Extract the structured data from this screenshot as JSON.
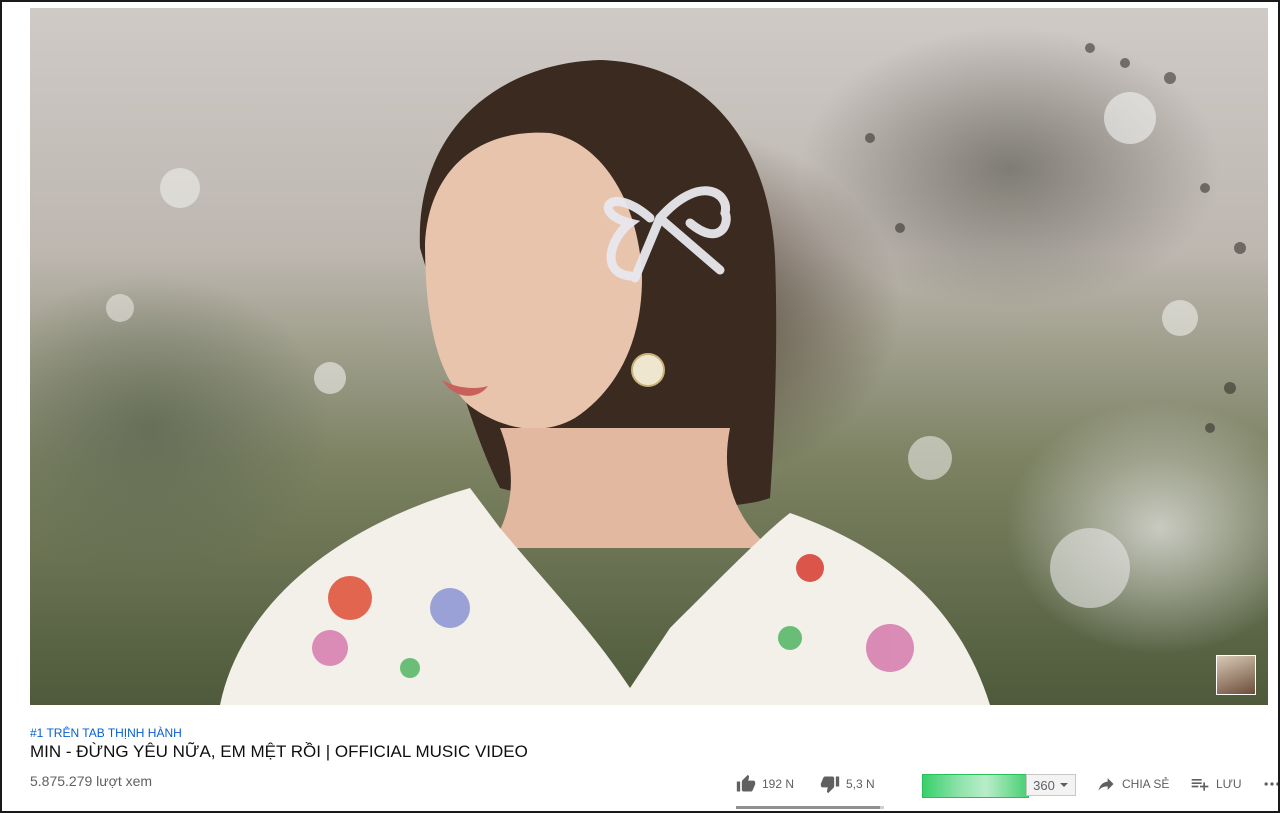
{
  "video": {
    "trending_label": "#1 TRÊN TAB THỊNH HÀNH",
    "title": "MIN - ĐỪNG YÊU NỮA, EM MỆT RỒI | OFFICIAL MUSIC VIDEO",
    "views": "5.875.279 lượt xem"
  },
  "actions": {
    "like_count": "192 N",
    "dislike_count": "5,3 N",
    "quality_value": "360",
    "share_label": "CHIA SẺ",
    "save_label": "LƯU",
    "like_ratio": 0.973,
    "quality_progress": 1.0
  },
  "icons": {
    "like": "thumbs-up-icon",
    "dislike": "thumbs-down-icon",
    "share": "share-arrow-icon",
    "save": "playlist-add-icon",
    "more": "more-horiz-icon",
    "dropdown": "chevron-down-icon"
  },
  "colors": {
    "trending_link": "#065fd4",
    "title_text": "#0f0f0f",
    "meta_text": "#606060",
    "quality_green": "#2bbf5a"
  }
}
